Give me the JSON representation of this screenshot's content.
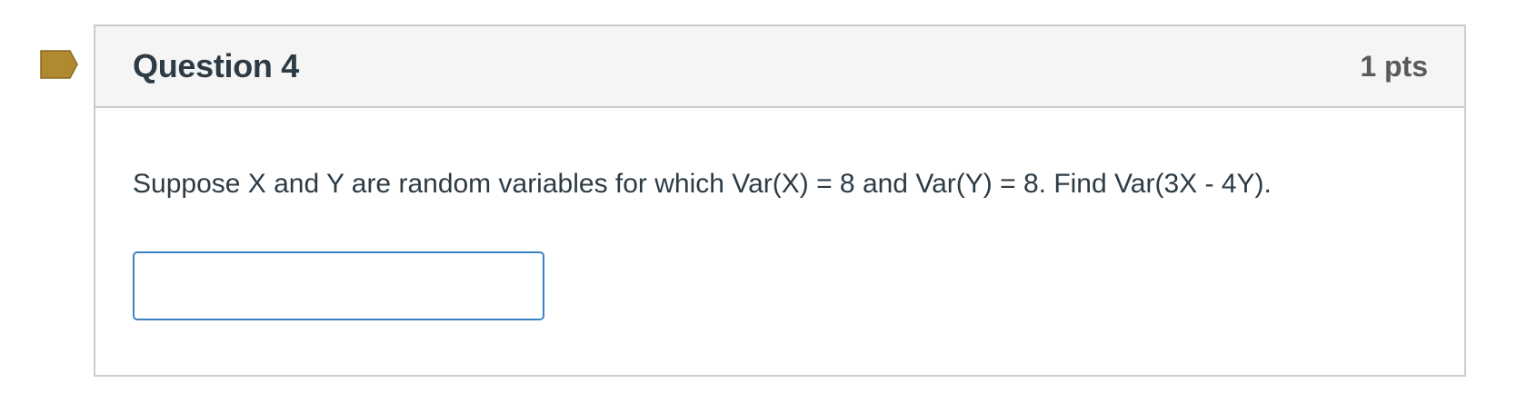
{
  "flag": {
    "icon": "bookmark-flag-icon",
    "color": "#b08a2e"
  },
  "question": {
    "title": "Question 4",
    "points": "1 pts",
    "text": "Suppose X and Y are random variables for which Var(X) = 8 and Var(Y) = 8. Find Var(3X - 4Y).",
    "answer": {
      "value": "",
      "placeholder": ""
    }
  },
  "colors": {
    "header_bg": "#f5f5f5",
    "border": "#c7cdd1",
    "text": "#2d3b45",
    "input_border": "#3b82c4"
  }
}
